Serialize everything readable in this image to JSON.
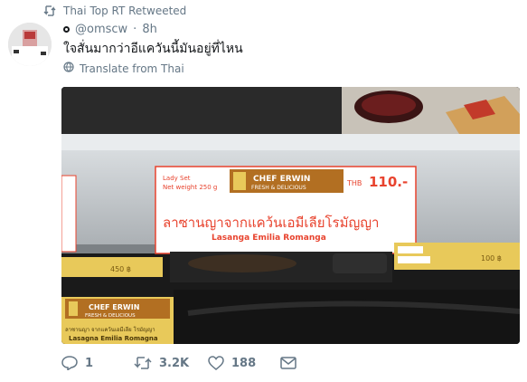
{
  "retweet": {
    "label": "Thai Top RT Retweeted"
  },
  "tweet": {
    "handle": "@omscw",
    "separator": "·",
    "time": "8h",
    "text": "ใจสั่นมากว่าอีแควันนี้มันอยู่ที่ไหน",
    "translate_label": "Translate from Thai"
  },
  "photo": {
    "card1": {
      "lady_set": "Lady Set",
      "net_weight": "Net weight 250 g",
      "brand": "CHEF ERWIN",
      "brand_tagline": "FRESH & DELICIOUS",
      "currency": "THB",
      "price": "110.-",
      "thai_name": "ลาซานญาจากแคว้นเอมีเลียโรมัญญา",
      "english_name": "Lasanga Emilia Romanga"
    },
    "card2": {
      "brand": "CHEF ERWIN",
      "brand_tagline": "FRESH & DELICIOUS",
      "thai_small": "ลาซานญา จากแคว้นเอมีเลีย โรมัญญา",
      "english_name": "Lasagna Emilia Romagna"
    },
    "left_tag_price": "450 ฿",
    "right_tag_price": "100 ฿"
  },
  "actions": {
    "replies": "1",
    "retweets": "3.2K",
    "likes": "188"
  },
  "colors": {
    "muted": "#657786",
    "text": "#14171a",
    "label_red": "#e8432e",
    "tag_yellow": "#e8c95a"
  }
}
